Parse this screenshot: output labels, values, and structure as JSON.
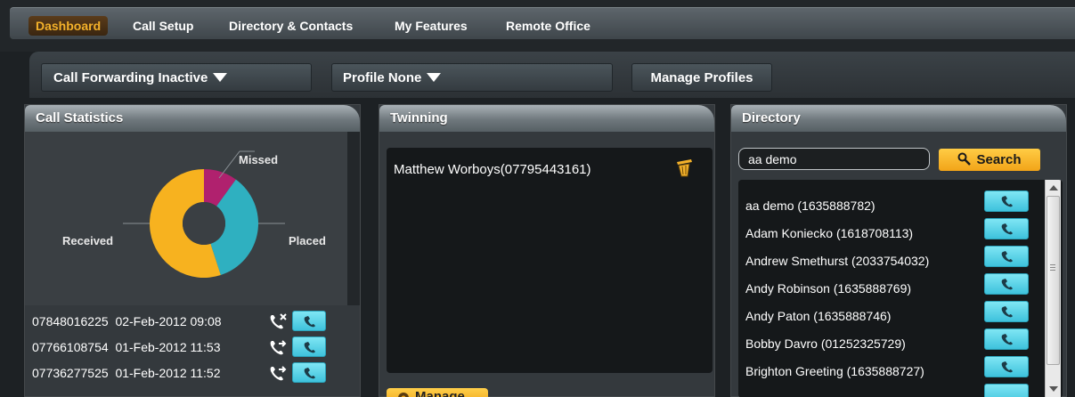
{
  "nav": {
    "items": [
      {
        "label": "Dashboard",
        "active": true
      },
      {
        "label": "Call Setup"
      },
      {
        "label": "Directory & Contacts"
      },
      {
        "label": "My Features"
      },
      {
        "label": "Remote Office"
      }
    ]
  },
  "toolbar": {
    "call_forwarding": "Call Forwarding Inactive",
    "profile": "Profile None",
    "manage_profiles": "Manage Profiles"
  },
  "call_statistics": {
    "title": "Call Statistics",
    "chart_data": {
      "type": "pie",
      "donut": true,
      "labels": [
        "Missed",
        "Placed",
        "Received"
      ],
      "values": [
        10,
        35,
        55
      ],
      "colors": [
        "#b0216e",
        "#2fb0c0",
        "#f7b21f"
      ]
    },
    "calls": [
      {
        "number": "07848016225",
        "datetime": "02-Feb-2012 09:08",
        "type": "missed-call-icon"
      },
      {
        "number": "07766108754",
        "datetime": "01-Feb-2012 11:53",
        "type": "placed-call-icon"
      },
      {
        "number": "07736277525",
        "datetime": "01-Feb-2012 11:52",
        "type": "placed-call-icon"
      }
    ]
  },
  "twinning": {
    "title": "Twinning",
    "entry": "Matthew Worboys(07795443161)",
    "manage_label": "Manage"
  },
  "directory": {
    "title": "Directory",
    "search_value": "aa demo",
    "search_label": "Search",
    "entries": [
      "aa demo (1635888782)",
      "Adam Koniecko (1618708113)",
      "Andrew Smethurst (2033754032)",
      "Andy Robinson (1635888769)",
      "Andy Paton (1635888746)",
      "Bobby Davro (01252325729)",
      "Brighton Greeting (1635888727)"
    ]
  },
  "colors": {
    "accent": "#f4b12a",
    "call_button": "#3ec2dc",
    "panel": "#34393d"
  }
}
